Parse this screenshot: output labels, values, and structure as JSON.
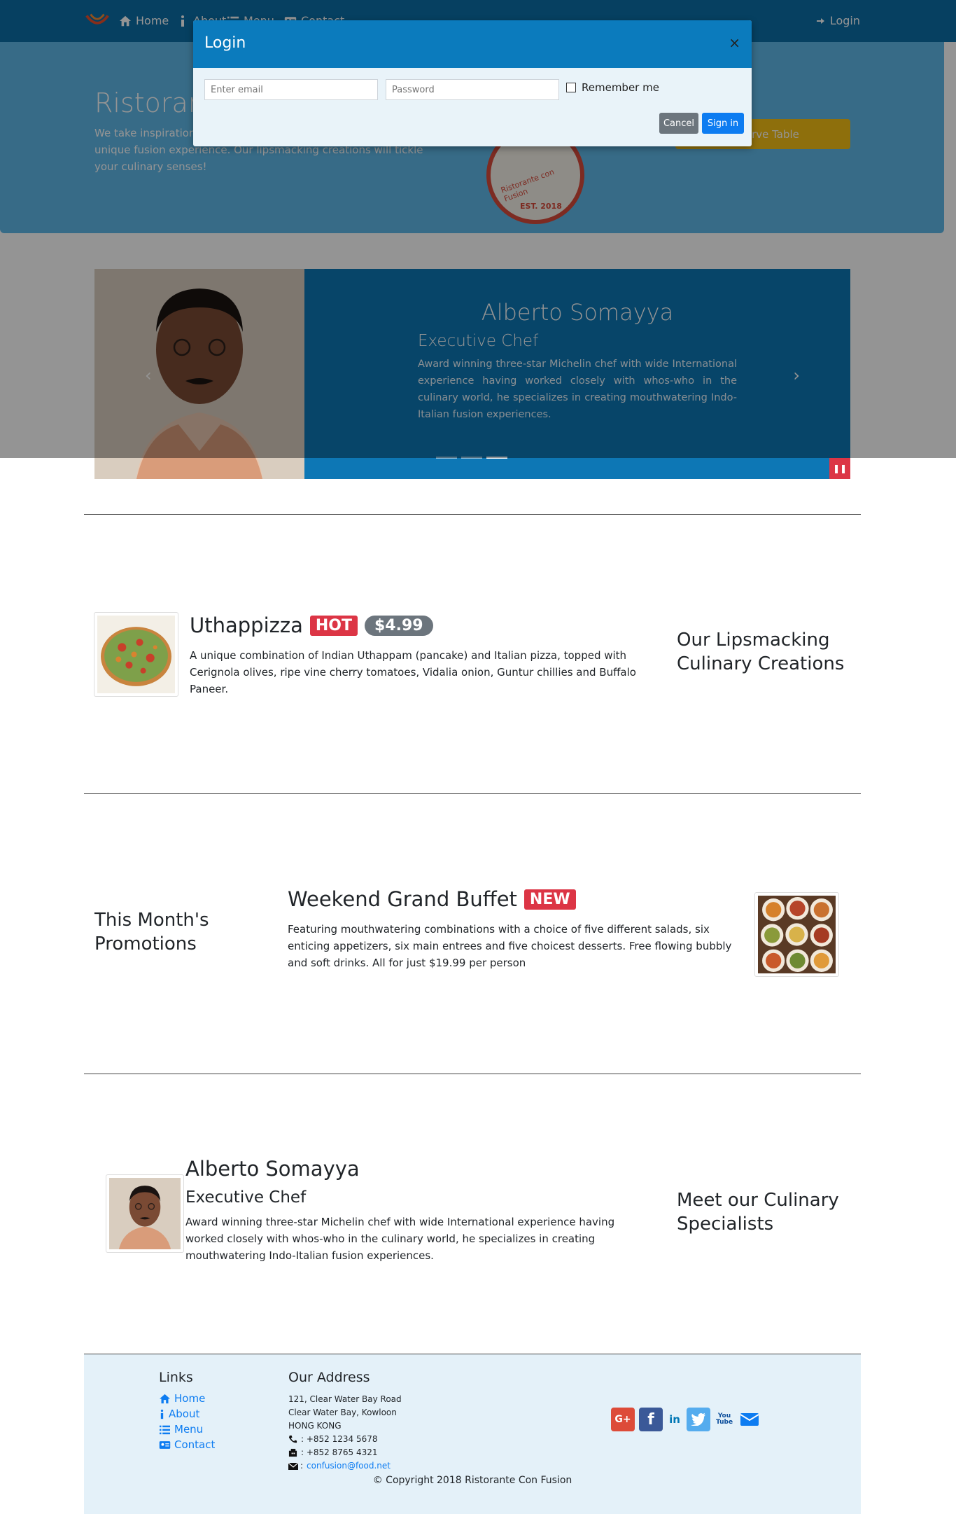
{
  "navbar": {
    "home": "Home",
    "about": "About",
    "menu": "Menu",
    "contact": "Contact",
    "login": "Login"
  },
  "jumbotron": {
    "title": "Ristorante con Fusion",
    "text": "We take inspiration from the World's best cuisines, and create a unique fusion experience. Our lipsmacking creations will tickle your culinary senses!",
    "reserve_label": "Reserve Table",
    "logo_text": "Ristorante con Fusion",
    "logo_est": "EST. 2018"
  },
  "modal": {
    "title": "Login",
    "close": "×",
    "email_placeholder": "Enter email",
    "password_placeholder": "Password",
    "remember_label": "Remember me",
    "cancel_label": "Cancel",
    "signin_label": "Sign in"
  },
  "carousel": {
    "name": "Alberto Somayya",
    "role": "Executive Chef",
    "description": "Award winning three-star Michelin chef with wide International experience having worked closely with whos-who in the culinary world, he specializes in creating mouthwatering Indo-Italian fusion experiences.",
    "prev": "‹",
    "next": "›",
    "pause": "❚❚",
    "slide_count": 3,
    "active_slide": 3
  },
  "dish": {
    "name": "Uthappizza",
    "badge_hot": "HOT",
    "price": "$4.99",
    "description": "A unique combination of Indian Uthappam (pancake) and Italian pizza, topped with Cerignola olives, ripe vine cherry tomatoes, Vidalia onion, Guntur chillies and Buffalo Paneer.",
    "side_heading": "Our Lipsmacking Culinary Creations"
  },
  "promotion": {
    "side_heading": "This Month's Promotions",
    "name": "Weekend Grand Buffet",
    "badge_new": "NEW",
    "description": "Featuring mouthwatering combinations with a choice of five different salads, six enticing appetizers, six main entrees and five choicest desserts. Free flowing bubbly and soft drinks. All for just $19.99 per person"
  },
  "leader": {
    "name": "Alberto Somayya",
    "role": "Executive Chef",
    "description": "Award winning three-star Michelin chef with wide International experience having worked closely with whos-who in the culinary world, he specializes in creating mouthwatering Indo-Italian fusion experiences.",
    "side_heading": "Meet our Culinary Specialists"
  },
  "footer": {
    "links_heading": "Links",
    "links": [
      "Home",
      "About",
      "Menu",
      "Contact"
    ],
    "address_heading": "Our Address",
    "address_lines": [
      "121, Clear Water Bay Road",
      "Clear Water Bay, Kowloon",
      "HONG KONG"
    ],
    "phone": ": +852 1234 5678",
    "fax": ": +852 8765 4321",
    "email": "confusion@food.net",
    "copyright": "© Copyright 2018 Ristorante Con Fusion",
    "social": {
      "google": "G+",
      "facebook": "f",
      "linkedin": "in",
      "youtube": "You Tube"
    }
  },
  "colors": {
    "navbar": "#0b6fa8",
    "jumbotron": "#5fb8e8",
    "carousel": "#0d77b5",
    "reserve": "#f5c016",
    "danger": "#dc3545",
    "primary": "#0d7cf1",
    "footer": "#e4f1f9"
  }
}
